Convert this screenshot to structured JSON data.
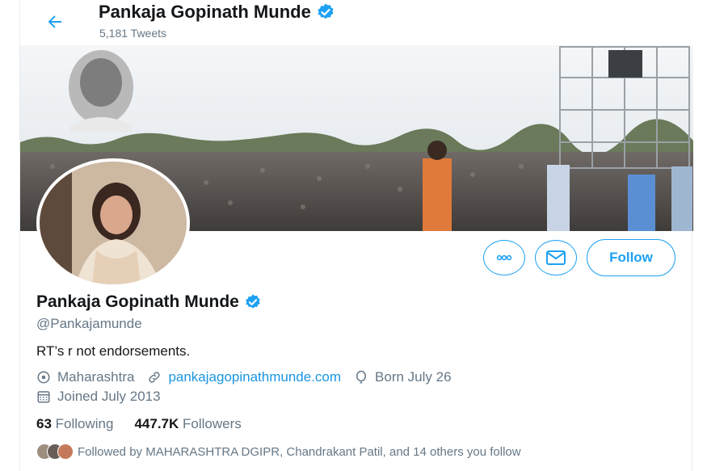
{
  "header": {
    "name": "Pankaja Gopinath Munde",
    "tweet_count": "5,181 Tweets"
  },
  "profile": {
    "name": "Pankaja Gopinath Munde",
    "handle": "@Pankajamunde",
    "bio": "RT’s r not endorsements.",
    "location": "Maharashtra",
    "website": "pankajagopinathmunde.com",
    "birthday": "Born July 26",
    "joined": "Joined July 2013"
  },
  "stats": {
    "following_count": "63",
    "following_label": "Following",
    "followers_count": "447.7K",
    "followers_label": "Followers"
  },
  "followed_by": "Followed by MAHARASHTRA DGIPR, Chandrakant Patil, and 14 others you follow",
  "buttons": {
    "follow": "Follow"
  },
  "colors": {
    "accent": "#1da1f2",
    "link": "#1b95e0",
    "muted": "#657786",
    "verified": "#1da1f2"
  }
}
